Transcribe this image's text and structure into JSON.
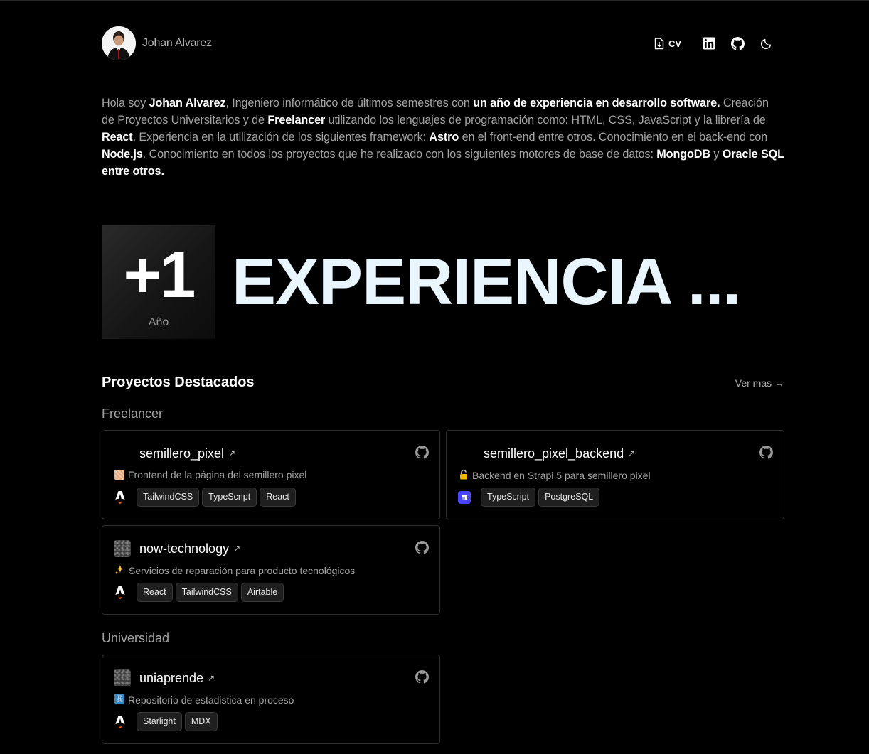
{
  "header": {
    "name": "Johan Alvarez",
    "cv_label": "CV",
    "nav_icons": [
      "download-file-icon",
      "linkedin-icon",
      "github-icon",
      "moon-icon"
    ]
  },
  "intro": {
    "p1": "Hola soy ",
    "b1": "Johan Alvarez",
    "p2": ", Ingeniero informático de últimos semestres con ",
    "b2": "un año de experiencia en desarrollo software.",
    "p3": " Creación de Proyectos Universitarios y de ",
    "b3": "Freelancer",
    "p4": " utilizando los lenguajes de programación como: HTML, CSS, JavaScript y la librería de ",
    "b4": "React",
    "p5": ". Experiencia en la utilización de los siguientes framework: ",
    "b5": "Astro",
    "p6": " en el front-end entre otros. Conocimiento en el back-end con ",
    "b6": "Node.js",
    "p7": ". Conocimiento en todos los proyectos que he realizado con los siguientes motores de base de datos: ",
    "b7": "MongoDB",
    "p8": " y ",
    "b8": "Oracle SQL entre otros."
  },
  "experience": {
    "number": "+1",
    "unit": "Año",
    "title": "EXPERIENCIA ..."
  },
  "projects": {
    "title": "Proyectos Destacados",
    "see_more": "Ver mas →",
    "groups": [
      {
        "title": "Freelancer",
        "items": [
          {
            "name": "semillero_pixel",
            "ext": "↗",
            "emoji": "🏻",
            "description": "Frontend de la página del semillero pixel",
            "framework": "astro-icon",
            "tags": [
              "TailwindCSS",
              "TypeScript",
              "React"
            ]
          },
          {
            "name": "semillero_pixel_backend",
            "ext": "↗",
            "emoji": "🔒",
            "description": "Backend en Strapi 5 para semillero pixel",
            "framework": "strapi-icon",
            "tags": [
              "TypeScript",
              "PostgreSQL"
            ]
          },
          {
            "name": "now-technology",
            "ext": "↗",
            "emoji": "✨",
            "description": "Servicios de reparación para producto tecnológicos",
            "framework": "astro-icon",
            "tags": [
              "React",
              "TailwindCSS",
              "Airtable"
            ]
          }
        ]
      },
      {
        "title": "Universidad",
        "items": [
          {
            "name": "uniaprende",
            "ext": "↗",
            "emoji": "🔢",
            "description": "Repositorio de estadistica en proceso",
            "framework": "astro-icon",
            "tags": [
              "Starlight",
              "MDX"
            ]
          }
        ]
      }
    ]
  },
  "colors": {
    "background": "#000000",
    "text_muted": "#a3a3a3",
    "title_light": "#eaf6fd",
    "card_border": "#2f2f2f",
    "tag_bg": "#1f1f1f"
  }
}
